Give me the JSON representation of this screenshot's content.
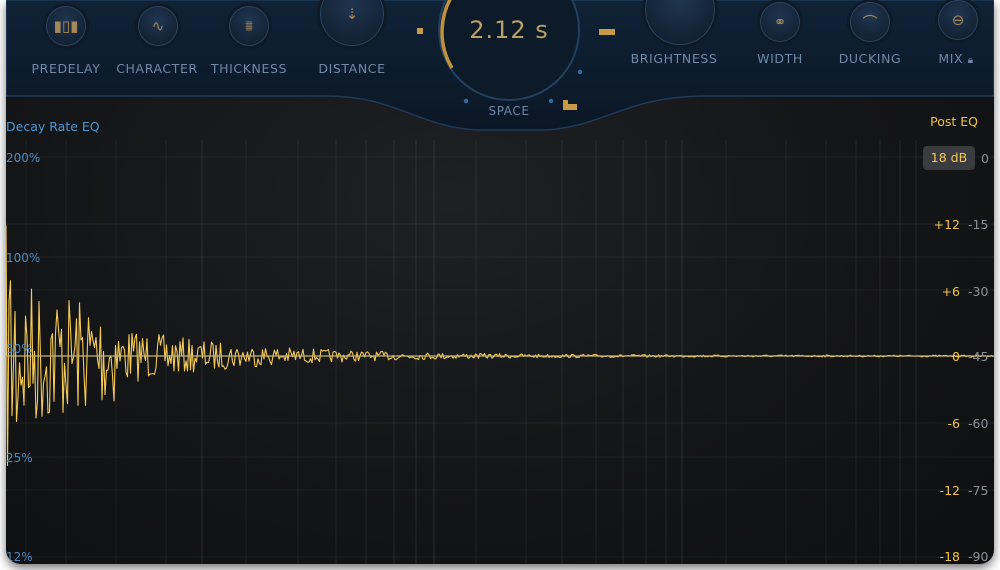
{
  "controls": {
    "predelay": "PREDELAY",
    "character": "CHARACTER",
    "thickness": "THICKNESS",
    "distance": "DISTANCE",
    "space": "SPACE",
    "space_value": "2.12 s",
    "brightness": "BRIGHTNESS",
    "width": "WIDTH",
    "ducking": "DUCKING",
    "mix": "MIX"
  },
  "eq": {
    "left_title": "Decay Rate EQ",
    "right_title": "Post EQ",
    "db_range": "18 dB",
    "left_scale": [
      "200%",
      "100%",
      "50%",
      "25%",
      "12%"
    ],
    "right_db": [
      "+12",
      "+6",
      "0",
      "-6",
      "-12",
      "-18"
    ],
    "right_num": [
      "0",
      "-15",
      "-30",
      "-45",
      "-60",
      "-75",
      "-90"
    ]
  },
  "colors": {
    "accent_gold": "#f3c754",
    "accent_blue": "#4e95d3",
    "background": "#141517"
  }
}
